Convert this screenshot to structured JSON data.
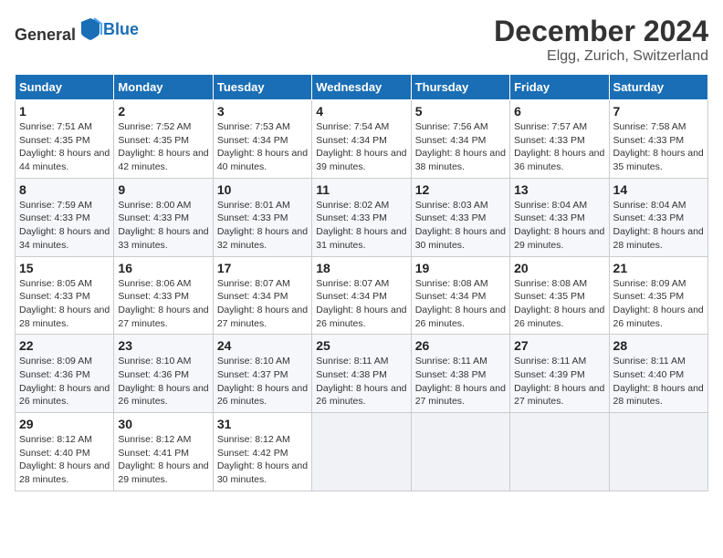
{
  "header": {
    "logo_general": "General",
    "logo_blue": "Blue",
    "month_title": "December 2024",
    "location": "Elgg, Zurich, Switzerland"
  },
  "days_of_week": [
    "Sunday",
    "Monday",
    "Tuesday",
    "Wednesday",
    "Thursday",
    "Friday",
    "Saturday"
  ],
  "weeks": [
    [
      {
        "day": "1",
        "sunrise": "7:51 AM",
        "sunset": "4:35 PM",
        "daylight": "8 hours and 44 minutes."
      },
      {
        "day": "2",
        "sunrise": "7:52 AM",
        "sunset": "4:35 PM",
        "daylight": "8 hours and 42 minutes."
      },
      {
        "day": "3",
        "sunrise": "7:53 AM",
        "sunset": "4:34 PM",
        "daylight": "8 hours and 40 minutes."
      },
      {
        "day": "4",
        "sunrise": "7:54 AM",
        "sunset": "4:34 PM",
        "daylight": "8 hours and 39 minutes."
      },
      {
        "day": "5",
        "sunrise": "7:56 AM",
        "sunset": "4:34 PM",
        "daylight": "8 hours and 38 minutes."
      },
      {
        "day": "6",
        "sunrise": "7:57 AM",
        "sunset": "4:33 PM",
        "daylight": "8 hours and 36 minutes."
      },
      {
        "day": "7",
        "sunrise": "7:58 AM",
        "sunset": "4:33 PM",
        "daylight": "8 hours and 35 minutes."
      }
    ],
    [
      {
        "day": "8",
        "sunrise": "7:59 AM",
        "sunset": "4:33 PM",
        "daylight": "8 hours and 34 minutes."
      },
      {
        "day": "9",
        "sunrise": "8:00 AM",
        "sunset": "4:33 PM",
        "daylight": "8 hours and 33 minutes."
      },
      {
        "day": "10",
        "sunrise": "8:01 AM",
        "sunset": "4:33 PM",
        "daylight": "8 hours and 32 minutes."
      },
      {
        "day": "11",
        "sunrise": "8:02 AM",
        "sunset": "4:33 PM",
        "daylight": "8 hours and 31 minutes."
      },
      {
        "day": "12",
        "sunrise": "8:03 AM",
        "sunset": "4:33 PM",
        "daylight": "8 hours and 30 minutes."
      },
      {
        "day": "13",
        "sunrise": "8:04 AM",
        "sunset": "4:33 PM",
        "daylight": "8 hours and 29 minutes."
      },
      {
        "day": "14",
        "sunrise": "8:04 AM",
        "sunset": "4:33 PM",
        "daylight": "8 hours and 28 minutes."
      }
    ],
    [
      {
        "day": "15",
        "sunrise": "8:05 AM",
        "sunset": "4:33 PM",
        "daylight": "8 hours and 28 minutes."
      },
      {
        "day": "16",
        "sunrise": "8:06 AM",
        "sunset": "4:33 PM",
        "daylight": "8 hours and 27 minutes."
      },
      {
        "day": "17",
        "sunrise": "8:07 AM",
        "sunset": "4:34 PM",
        "daylight": "8 hours and 27 minutes."
      },
      {
        "day": "18",
        "sunrise": "8:07 AM",
        "sunset": "4:34 PM",
        "daylight": "8 hours and 26 minutes."
      },
      {
        "day": "19",
        "sunrise": "8:08 AM",
        "sunset": "4:34 PM",
        "daylight": "8 hours and 26 minutes."
      },
      {
        "day": "20",
        "sunrise": "8:08 AM",
        "sunset": "4:35 PM",
        "daylight": "8 hours and 26 minutes."
      },
      {
        "day": "21",
        "sunrise": "8:09 AM",
        "sunset": "4:35 PM",
        "daylight": "8 hours and 26 minutes."
      }
    ],
    [
      {
        "day": "22",
        "sunrise": "8:09 AM",
        "sunset": "4:36 PM",
        "daylight": "8 hours and 26 minutes."
      },
      {
        "day": "23",
        "sunrise": "8:10 AM",
        "sunset": "4:36 PM",
        "daylight": "8 hours and 26 minutes."
      },
      {
        "day": "24",
        "sunrise": "8:10 AM",
        "sunset": "4:37 PM",
        "daylight": "8 hours and 26 minutes."
      },
      {
        "day": "25",
        "sunrise": "8:11 AM",
        "sunset": "4:38 PM",
        "daylight": "8 hours and 26 minutes."
      },
      {
        "day": "26",
        "sunrise": "8:11 AM",
        "sunset": "4:38 PM",
        "daylight": "8 hours and 27 minutes."
      },
      {
        "day": "27",
        "sunrise": "8:11 AM",
        "sunset": "4:39 PM",
        "daylight": "8 hours and 27 minutes."
      },
      {
        "day": "28",
        "sunrise": "8:11 AM",
        "sunset": "4:40 PM",
        "daylight": "8 hours and 28 minutes."
      }
    ],
    [
      {
        "day": "29",
        "sunrise": "8:12 AM",
        "sunset": "4:40 PM",
        "daylight": "8 hours and 28 minutes."
      },
      {
        "day": "30",
        "sunrise": "8:12 AM",
        "sunset": "4:41 PM",
        "daylight": "8 hours and 29 minutes."
      },
      {
        "day": "31",
        "sunrise": "8:12 AM",
        "sunset": "4:42 PM",
        "daylight": "8 hours and 30 minutes."
      },
      null,
      null,
      null,
      null
    ]
  ],
  "labels": {
    "sunrise": "Sunrise: ",
    "sunset": "Sunset: ",
    "daylight": "Daylight: "
  }
}
